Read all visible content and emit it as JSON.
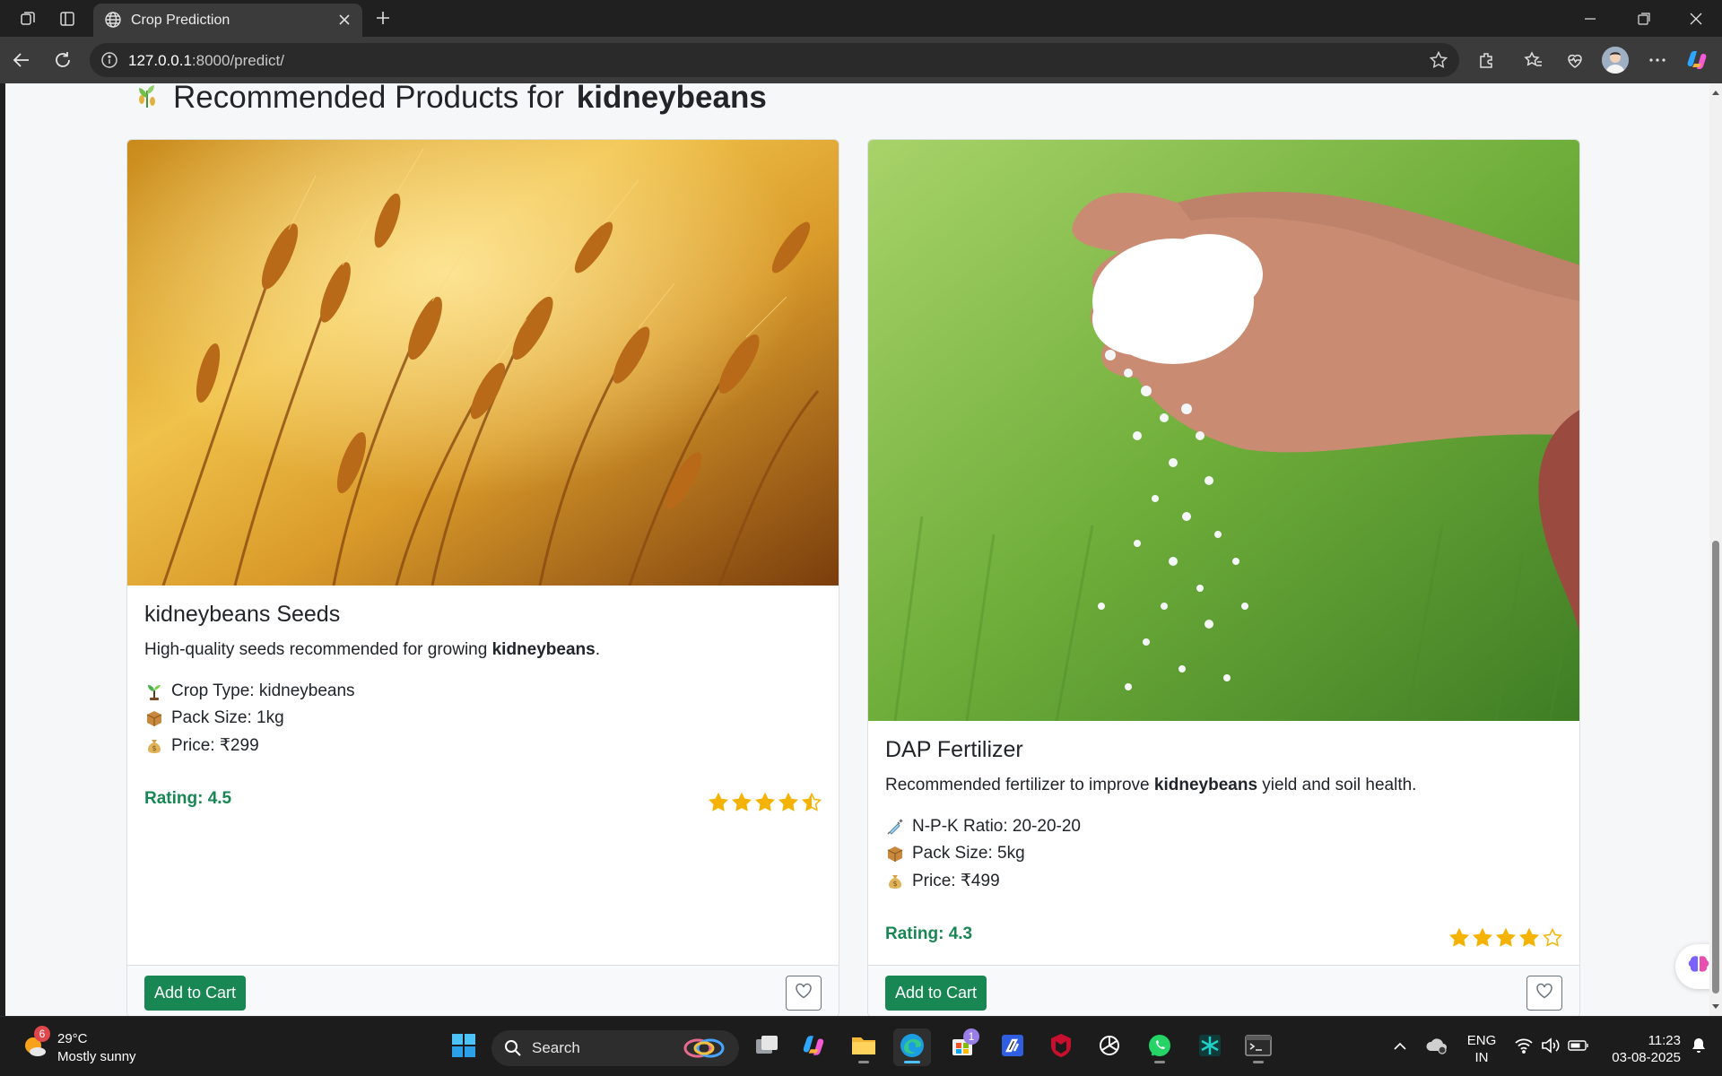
{
  "browser": {
    "tab_title": "Crop Prediction",
    "url_host": "127.0.0.1",
    "url_rest": ":8000/predict/"
  },
  "page": {
    "heading_prefix": "Recommended Products for",
    "heading_crop": "kidneybeans",
    "heading_icon": "wheat-sprout-icon"
  },
  "products": [
    {
      "title": "kidneybeans Seeds",
      "desc_prefix": "High-quality seeds recommended for growing",
      "desc_crop": "kidneybeans",
      "desc_suffix": ".",
      "specs": [
        {
          "icon": "seedling-icon",
          "text": "Crop Type: kidneybeans"
        },
        {
          "icon": "package-icon",
          "text": "Pack Size: 1kg"
        },
        {
          "icon": "money-bag-icon",
          "text": "Price: ₹299"
        }
      ],
      "rating_text": "Rating: 4.5",
      "rating": 4.5,
      "cart_label": "Add to Cart",
      "image": "golden wheat field photo"
    },
    {
      "title": "DAP Fertilizer",
      "desc_prefix": "Recommended fertilizer to improve",
      "desc_crop": "kidneybeans",
      "desc_suffix": "yield and soil health.",
      "specs": [
        {
          "icon": "syringe-icon",
          "text": "N-P-K Ratio: 20-20-20"
        },
        {
          "icon": "package-icon",
          "text": "Pack Size: 5kg"
        },
        {
          "icon": "money-bag-icon",
          "text": "Price: ₹499"
        }
      ],
      "rating_text": "Rating: 4.3",
      "rating": 4.3,
      "cart_label": "Add to Cart",
      "image": "hand holding white fertilizer granules photo"
    }
  ],
  "taskbar": {
    "weather_badge": "6",
    "weather_temp": "29°C",
    "weather_desc": "Mostly sunny",
    "search_label": "Search",
    "store_badge": "1",
    "lang_line1": "ENG",
    "lang_line2": "IN",
    "time": "11:23",
    "date": "03-08-2025"
  },
  "colors": {
    "success": "#198754",
    "star": "#f5b301",
    "chrome_bg": "#202020",
    "toolbar_bg": "#3b3b3b"
  }
}
